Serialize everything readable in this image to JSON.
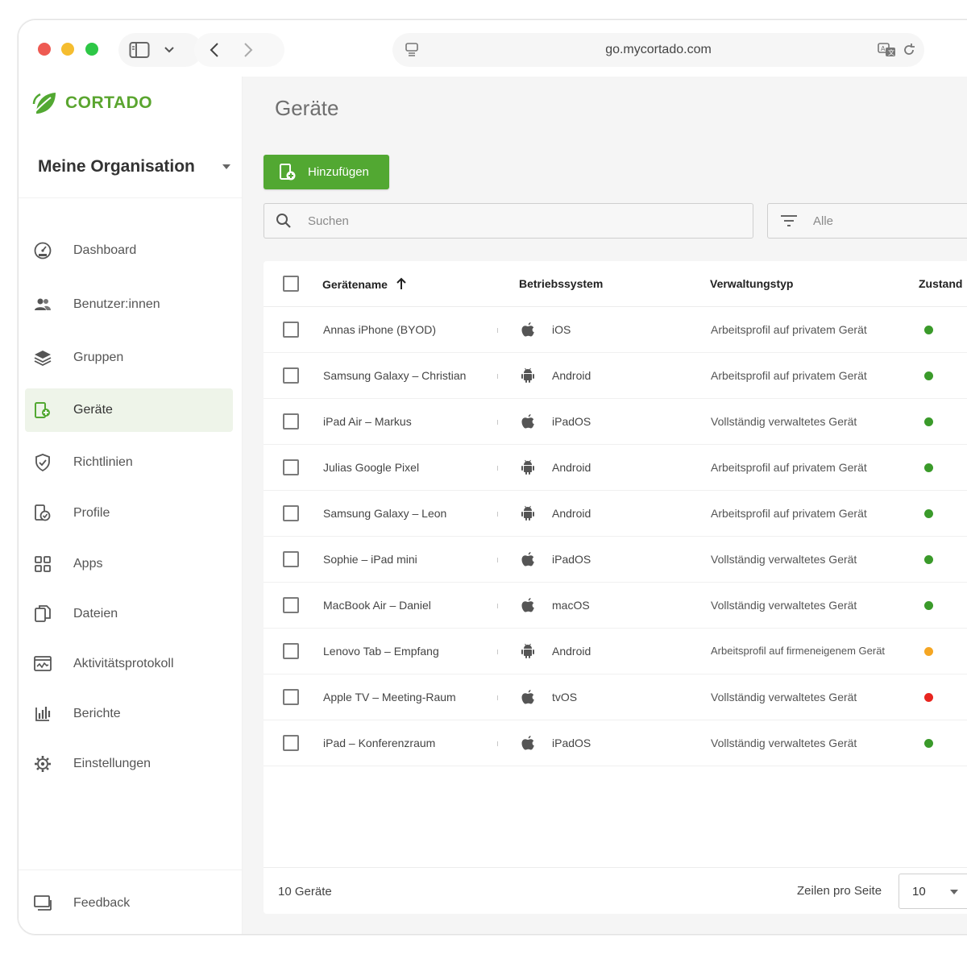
{
  "browser": {
    "url": "go.mycortado.com"
  },
  "brand": {
    "name": "CORTADO",
    "accent": "#52a832"
  },
  "org": {
    "name": "Meine Organisation"
  },
  "sidebar": {
    "items": [
      {
        "label": "Dashboard",
        "icon": "dashboard-icon",
        "active": false
      },
      {
        "label": "Benutzer:innen",
        "icon": "users-icon",
        "active": false
      },
      {
        "label": "Gruppen",
        "icon": "layers-icon",
        "active": false
      },
      {
        "label": "Geräte",
        "icon": "device-icon",
        "active": true
      },
      {
        "label": "Richtlinien",
        "icon": "shield-icon",
        "active": false
      },
      {
        "label": "Profile",
        "icon": "profile-icon",
        "active": false
      },
      {
        "label": "Apps",
        "icon": "apps-grid-icon",
        "active": false
      },
      {
        "label": "Dateien",
        "icon": "files-icon",
        "active": false
      },
      {
        "label": "Aktivitätsprotokoll",
        "icon": "activity-log-icon",
        "active": false
      },
      {
        "label": "Berichte",
        "icon": "reports-icon",
        "active": false
      },
      {
        "label": "Einstellungen",
        "icon": "settings-icon",
        "active": false
      }
    ],
    "feedback": "Feedback"
  },
  "main": {
    "title": "Geräte",
    "add_button": "Hinzufügen",
    "search_placeholder": "Suchen",
    "filter_label": "Alle"
  },
  "table": {
    "columns": {
      "name": "Gerätename",
      "os": "Betriebssystem",
      "management": "Verwaltungstyp",
      "state": "Zustand"
    },
    "rows": [
      {
        "name": "Annas iPhone (BYOD)",
        "os": "iOS",
        "os_icon": "apple-icon",
        "management": "Arbeitsprofil auf privatem Gerät",
        "status_color": "#3a9a2a"
      },
      {
        "name": "Samsung Galaxy – Christian",
        "os": "Android",
        "os_icon": "android-icon",
        "management": "Arbeitsprofil auf privatem Gerät",
        "status_color": "#3a9a2a"
      },
      {
        "name": "iPad Air – Markus",
        "os": "iPadOS",
        "os_icon": "apple-icon",
        "management": "Vollständig verwaltetes Gerät",
        "status_color": "#3a9a2a"
      },
      {
        "name": "Julias Google Pixel",
        "os": "Android",
        "os_icon": "android-icon",
        "management": "Arbeitsprofil auf privatem Gerät",
        "status_color": "#3a9a2a"
      },
      {
        "name": "Samsung Galaxy – Leon",
        "os": "Android",
        "os_icon": "android-icon",
        "management": "Arbeitsprofil auf privatem Gerät",
        "status_color": "#3a9a2a"
      },
      {
        "name": "Sophie – iPad mini",
        "os": "iPadOS",
        "os_icon": "apple-icon",
        "management": "Vollständig verwaltetes Gerät",
        "status_color": "#3a9a2a"
      },
      {
        "name": "MacBook Air – Daniel",
        "os": "macOS",
        "os_icon": "apple-icon",
        "management": "Vollständig verwaltetes Gerät",
        "status_color": "#3a9a2a"
      },
      {
        "name": "Lenovo Tab – Empfang",
        "os": "Android",
        "os_icon": "android-icon",
        "management": "Arbeitsprofil auf firmeneigenem Gerät",
        "status_color": "#f5a623"
      },
      {
        "name": "Apple TV – Meeting-Raum",
        "os": "tvOS",
        "os_icon": "apple-icon",
        "management": "Vollständig verwaltetes Gerät",
        "status_color": "#e8251f"
      },
      {
        "name": "iPad – Konferenzraum",
        "os": "iPadOS",
        "os_icon": "apple-icon",
        "management": "Vollständig verwaltetes Gerät",
        "status_color": "#3a9a2a"
      }
    ],
    "footer": {
      "count": "10 Geräte",
      "rows_per_page_label": "Zeilen pro Seite",
      "rows_per_page_value": "10"
    }
  }
}
